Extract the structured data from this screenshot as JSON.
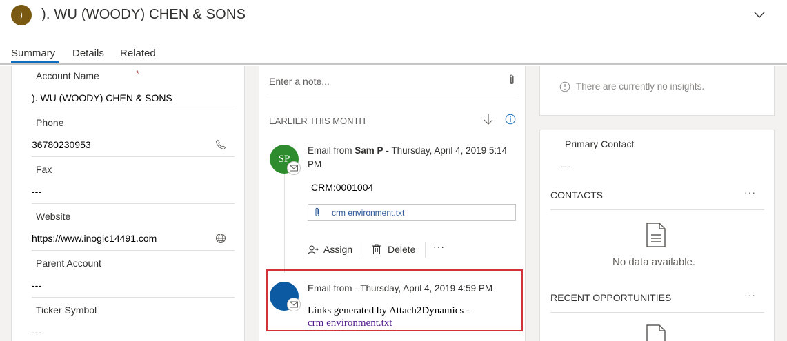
{
  "header": {
    "avatar_initial": ")",
    "title": "). WU (WOODY) CHEN & SONS"
  },
  "tabs": [
    {
      "label": "Summary",
      "active": true
    },
    {
      "label": "Details",
      "active": false
    },
    {
      "label": "Related",
      "active": false
    }
  ],
  "fields": {
    "account_name": {
      "label": "Account Name",
      "required_mark": "*",
      "value": "). WU (WOODY) CHEN & SONS"
    },
    "phone": {
      "label": "Phone",
      "value": "36780230953"
    },
    "fax": {
      "label": "Fax",
      "value": "---"
    },
    "website": {
      "label": "Website",
      "value": "https://www.inogic14491.com"
    },
    "parent_account": {
      "label": "Parent Account",
      "value": "---"
    },
    "ticker_symbol": {
      "label": "Ticker Symbol",
      "value": "---"
    }
  },
  "timeline": {
    "note_placeholder": "Enter a note...",
    "section_header": "EARLIER THIS MONTH",
    "items": [
      {
        "avatar_initials": "SP",
        "avatar_color": "#2e8b2e",
        "prefix": "Email from",
        "sender": "Sam P",
        "date": "-  Thursday, April 4, 2019 5:14",
        "date_cont": "PM",
        "subject": "CRM:0001004",
        "attachment": "crm environment.txt",
        "actions": {
          "assign": "Assign",
          "delete": "Delete",
          "more": "···"
        }
      },
      {
        "avatar_color": "#0b5aa2",
        "header": "Email from  -  Thursday, April 4, 2019 4:59 PM",
        "body": "Links generated by Attach2Dynamics -",
        "link": "crm environment.txt"
      }
    ]
  },
  "insights": {
    "empty_text": "There are currently no insights."
  },
  "primary_contact": {
    "label": "Primary Contact",
    "value": "---"
  },
  "contacts": {
    "title": "CONTACTS",
    "more": "···",
    "empty_text": "No data available."
  },
  "recent_opportunities": {
    "title": "RECENT OPPORTUNITIES",
    "more": "···"
  },
  "colors": {
    "accent": "#0f6cbd",
    "highlight_border": "#d13438",
    "header_avatar": "#7a5a12"
  },
  "icons": [
    "chevron-down-icon",
    "phone-icon",
    "globe-icon",
    "paperclip-icon",
    "sort-down-icon",
    "info-icon",
    "email-icon",
    "assign-icon",
    "delete-icon",
    "document-icon"
  ]
}
